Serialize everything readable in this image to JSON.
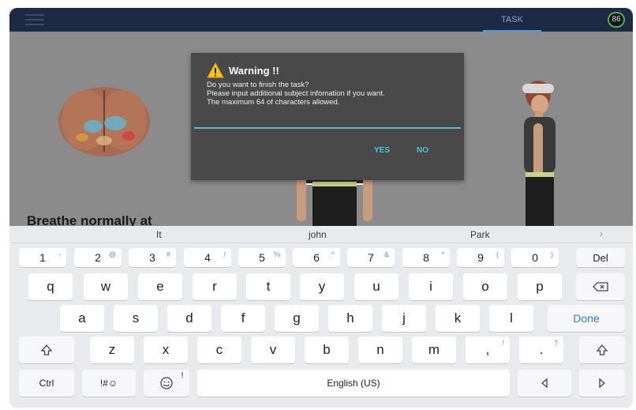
{
  "header": {
    "tab_task": "TASK",
    "badge_count": "86",
    "accent_color": "#4caf50"
  },
  "content": {
    "instruction": "Breathe normally at"
  },
  "dialog": {
    "title": "Warning !!",
    "message_lines": [
      "Do you want to finish the task?",
      "Please input additional subject infomation if you want.",
      "The maximum 64 of characters allowed."
    ],
    "input_value": "",
    "yes_label": "YES",
    "no_label": "NO",
    "icon": "warning-icon"
  },
  "keyboard": {
    "suggestions": [
      "It",
      "john",
      "Park"
    ],
    "suggest_more": "›",
    "number_row": [
      {
        "main": "1",
        "sub": "-"
      },
      {
        "main": "2",
        "sub": "@"
      },
      {
        "main": "3",
        "sub": "#"
      },
      {
        "main": "4",
        "sub": "/"
      },
      {
        "main": "5",
        "sub": "%"
      },
      {
        "main": "6",
        "sub": "^"
      },
      {
        "main": "7",
        "sub": "&"
      },
      {
        "main": "8",
        "sub": "*"
      },
      {
        "main": "9",
        "sub": "("
      },
      {
        "main": "0",
        "sub": ")"
      }
    ],
    "del_label": "Del",
    "row2": [
      "q",
      "w",
      "e",
      "r",
      "t",
      "y",
      "u",
      "i",
      "o",
      "p"
    ],
    "row3": [
      "a",
      "s",
      "d",
      "f",
      "g",
      "h",
      "j",
      "k",
      "l"
    ],
    "done_label": "Done",
    "row4": [
      "z",
      "x",
      "c",
      "v",
      "b",
      "n",
      "m"
    ],
    "comma": {
      "main": ",",
      "sub": "!"
    },
    "period": {
      "main": ".",
      "sub": "?"
    },
    "ctrl_label": "Ctrl",
    "symbols_label": "!#☺",
    "space_label": "English (US)"
  }
}
